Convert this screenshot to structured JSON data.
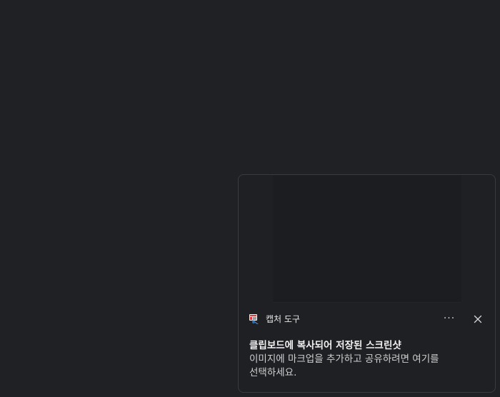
{
  "toast": {
    "app_icon": "snipping-tool-icon",
    "app_name": "캡처 도구",
    "more_label": "···",
    "close_icon": "close-icon",
    "title": "클립보드에 복사되어 저장된 스크린샷",
    "message": "이미지에 마크업을 추가하고 공유하려면 여기를 선택하세요."
  }
}
